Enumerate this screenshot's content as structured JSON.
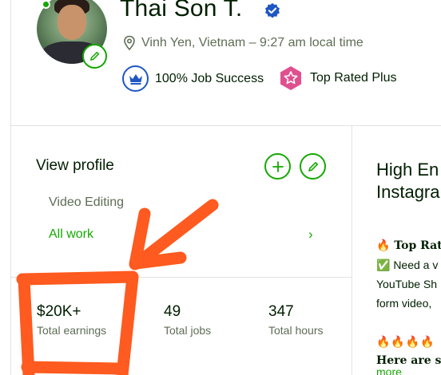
{
  "profile": {
    "name": "Thai Son T.",
    "location": "Vinh Yen, Vietnam – 9:27 am local time",
    "badges": {
      "job_success": "100% Job Success",
      "top_rated": "Top Rated Plus"
    }
  },
  "sidebar": {
    "view_profile": "View profile",
    "specialized": "Video Editing",
    "all_work": "All work",
    "chevron": "›"
  },
  "stats": [
    {
      "value": "$20K+",
      "label": "Total earnings"
    },
    {
      "value": "49",
      "label": "Total jobs"
    },
    {
      "value": "347",
      "label": "Total hours"
    }
  ],
  "overview": {
    "title_line1": "High En",
    "title_line2": "Instagra",
    "line1": "🔥 Top Rat",
    "line2": "✅ Need a v",
    "line3": "YouTube Sh",
    "line4": "form video,",
    "line5": "🔥🔥🔥🔥",
    "line6": "Here are so",
    "more": "more"
  },
  "colors": {
    "accent_green": "#14a800",
    "verified_blue": "#1f57c3",
    "top_rated_pink": "#e0508f",
    "annotation_orange": "#ff5a1f"
  },
  "icons": {
    "location": "map-pin-icon",
    "verified": "verified-badge-icon",
    "job_success": "crown-icon",
    "top_rated": "star-hexagon-icon",
    "add": "plus-icon",
    "edit": "pencil-icon"
  }
}
